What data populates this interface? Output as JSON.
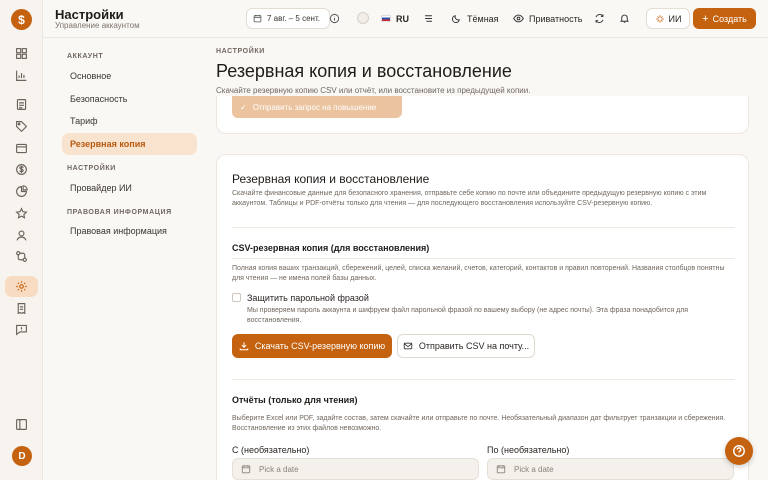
{
  "header": {
    "title": "Настройки",
    "subtitle": "Управление аккаунтом",
    "date_range": "7 авг. – 5 сент.",
    "language": "RU",
    "theme": "Тёмная",
    "privacy": "Приватность",
    "ai_label": "ИИ",
    "create_label": "Создать"
  },
  "rail": {
    "logo": "$",
    "avatar_initial": "D"
  },
  "subnav": {
    "sections": [
      {
        "title": "АККАУНТ",
        "items": [
          "Основное",
          "Безопасность",
          "Тариф",
          "Резервная копия"
        ]
      },
      {
        "title": "НАСТРОЙКИ",
        "items": [
          "Провайдер ИИ"
        ]
      },
      {
        "title": "ПРАВОВАЯ ИНФОРМАЦИЯ",
        "items": [
          "Правовая информация"
        ]
      }
    ],
    "active_item": "Резервная копия"
  },
  "page": {
    "breadcrumb": "НАСТРОЙКИ",
    "title": "Резервная копия и восстановление",
    "description": "Скачайте резервную копию CSV или отчёт, или восстановите из предыдущей копии.",
    "upgrade_button": "Отправить запрос на повышение"
  },
  "card": {
    "title": "Резервная копия и восстановление",
    "description": "Скачайте финансовые данные для безопасного хранения, отправьте себе копию по почте или объедините предыдущую резервную копию с этим аккаунтом. Таблицы и PDF-отчёты только для чтения — для последующего восстановления используйте CSV-резервную копию.",
    "csv": {
      "title": "CSV-резервная копия (для восстановления)",
      "description": "Полная копия ваших транзакций, сбережений, целей, списка желаний, счетов, категорий, контактов и правил повторений. Названия столбцов понятны для чтения — не имена полей базы данных.",
      "password_label": "Защитить парольной фразой",
      "password_hint": "Мы проверяем пароль аккаунта и шифруем файл парольной фразой по вашему выбору (не адрес почты). Эта фраза понадобится для восстановления.",
      "password_checked": false,
      "download_button": "Скачать CSV-резервную копию",
      "email_button": "Отправить CSV на почту..."
    },
    "reports": {
      "title": "Отчёты (только для чтения)",
      "description": "Выберите Excel или PDF, задайте состав, затем скачайте или отправьте по почте. Необязательный диапазон дат фильтрует транзакции и сбережения. Восстановление из этих файлов невозможно.",
      "from_label": "С (необязательно)",
      "to_label": "По (необязательно)",
      "date_placeholder": "Pick a date"
    }
  },
  "colors": {
    "accent": "#c4620f",
    "accent_soft": "#f8e3cf",
    "background": "#faf8f5"
  }
}
